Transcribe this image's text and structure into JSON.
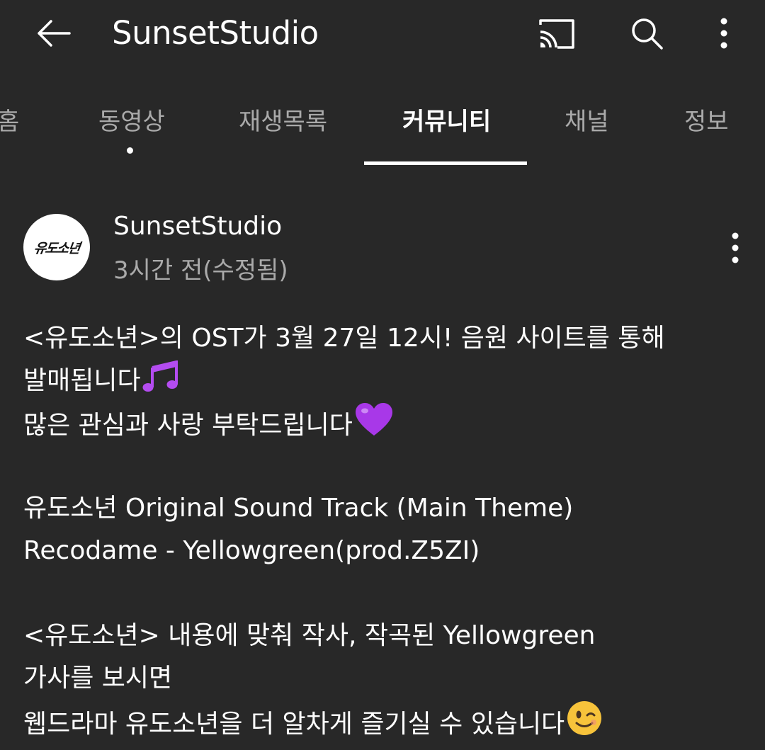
{
  "header": {
    "title": "SunsetStudio",
    "back_icon": "arrow-left-icon",
    "cast_icon": "cast-icon",
    "search_icon": "search-icon",
    "more_icon": "more-vertical-icon"
  },
  "tabs": [
    {
      "label": "홈",
      "active": false
    },
    {
      "label": "동영상",
      "active": false,
      "has_new_dot": true
    },
    {
      "label": "재생목록",
      "active": false
    },
    {
      "label": "커뮤니티",
      "active": true
    },
    {
      "label": "채널",
      "active": false
    },
    {
      "label": "정보",
      "active": false
    }
  ],
  "post": {
    "avatar_text": "유도소년",
    "author": "SunsetStudio",
    "time": "3시간 전(수정됨)",
    "menu_icon": "more-vertical-icon",
    "lines": [
      "<유도소년>의 OST가 3월 27일 12시! 음원 사이트를 통해",
      "발매됩니다",
      "많은 관심과 사랑 부탁드립니다",
      "",
      "유도소년 Original Sound Track (Main Theme)",
      "Recodame - Yellowgreen(prod.Z5ZI)",
      "",
      "<유도소년> 내용에 맞춰 작사, 작곡된 Yellowgreen",
      "가사를 보시면",
      "웹드라마 유도소년을 더 알차게 즐기실 수 있습니다"
    ],
    "line_emojis": {
      "1": "music-notes-emoji",
      "2": "purple-heart-emoji",
      "9": "winking-face-emoji"
    }
  },
  "colors": {
    "background": "#282828",
    "text_primary": "#ffffff",
    "text_secondary": "#aaaaaa",
    "accent_purple": "#b44cf0",
    "emoji_yellow": "#f7c33b"
  }
}
